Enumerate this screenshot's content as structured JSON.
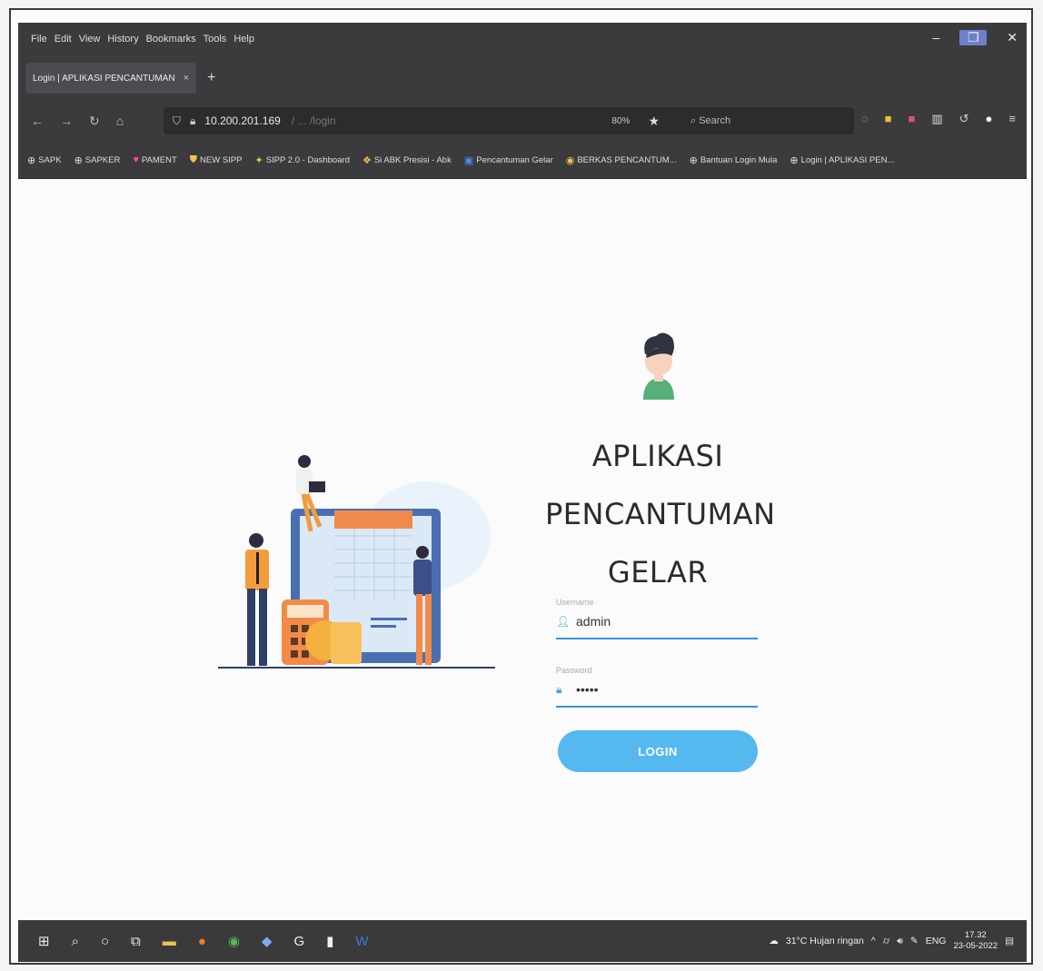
{
  "menu": [
    "File",
    "Edit",
    "View",
    "History",
    "Bookmarks",
    "Tools",
    "Help"
  ],
  "tab": {
    "title": "Login | APLIKASI PENCANTUMAN",
    "close": "×",
    "new": "+"
  },
  "address": {
    "url": "10.200.201.169",
    "url_dim": "/ ... /login",
    "zoom": "80%",
    "search_placeholder": "Search"
  },
  "bookmarks": [
    {
      "icon": "globe-icon",
      "label": "SAPK"
    },
    {
      "icon": "globe-icon",
      "label": "SAPKER"
    },
    {
      "icon": "heart-icon",
      "label": "PAMENT"
    },
    {
      "icon": "shield-icon",
      "label": "NEW SIPP"
    },
    {
      "icon": "star-icon",
      "label": "SIPP 2.0 - Dashboard"
    },
    {
      "icon": "folder-icon",
      "label": "Si ABK Presisi - Abk"
    },
    {
      "icon": "app-icon",
      "label": "Pencantuman Gelar"
    },
    {
      "icon": "doc-icon",
      "label": "BERKAS PENCANTUM..."
    },
    {
      "icon": "globe-icon",
      "label": "Bantuan Login Mula"
    },
    {
      "icon": "globe-icon",
      "label": "Login | APLIKASI PEN..."
    }
  ],
  "app": {
    "title_lines": [
      "APLIKASI",
      "PENCANTUMAN",
      "GELAR"
    ],
    "username_label": "Username",
    "username_value": "admin",
    "password_label": "Password",
    "password_value": "•••••",
    "login_label": "LOGIN"
  },
  "taskbar": {
    "weather": "31°C  Hujan ringan",
    "lang": "ENG",
    "time": "17.32",
    "date": "23-05-2022"
  }
}
